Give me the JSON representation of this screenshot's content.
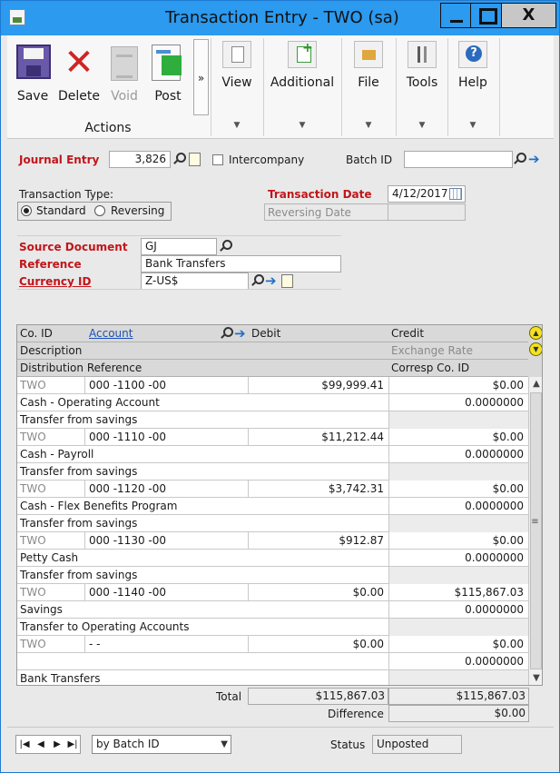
{
  "window": {
    "title": "Transaction Entry  -  TWO (sa)",
    "close_glyph": "X"
  },
  "ribbon": {
    "save": "Save",
    "delete": "Delete",
    "void": "Void",
    "post": "Post",
    "more": "»",
    "group_actions": "Actions",
    "view": "View",
    "additional": "Additional",
    "file": "File",
    "tools": "Tools",
    "help": "Help"
  },
  "header": {
    "journal_entry_label": "Journal Entry",
    "journal_entry_value": "3,826",
    "intercompany_label": "Intercompany",
    "batch_id_label": "Batch ID",
    "batch_id_value": "",
    "transaction_type_label": "Transaction Type:",
    "type_standard": "Standard",
    "type_reversing": "Reversing",
    "transaction_date_label": "Transaction Date",
    "transaction_date_value": "4/12/2017",
    "reversing_date_label": "Reversing Date",
    "reversing_date_value": "",
    "source_document_label": "Source Document",
    "source_document_value": "GJ",
    "reference_label": "Reference",
    "reference_value": "Bank Transfers",
    "currency_id_label": "Currency ID",
    "currency_id_value": "Z-US$"
  },
  "grid": {
    "headers": {
      "co_id": "Co. ID",
      "account": "Account",
      "debit": "Debit",
      "credit": "Credit",
      "description": "Description",
      "exchange_rate": "Exchange Rate",
      "distribution_reference": "Distribution Reference",
      "corresp_co_id": "Corresp Co. ID"
    },
    "entries": [
      {
        "co": "TWO",
        "account": "000 -1100 -00",
        "debit": "$99,999.41",
        "credit": "$0.00",
        "description": "Cash - Operating Account",
        "rate": "0.0000000",
        "dist_ref": "Transfer from savings"
      },
      {
        "co": "TWO",
        "account": "000 -1110 -00",
        "debit": "$11,212.44",
        "credit": "$0.00",
        "description": "Cash - Payroll",
        "rate": "0.0000000",
        "dist_ref": "Transfer from savings"
      },
      {
        "co": "TWO",
        "account": "000 -1120 -00",
        "debit": "$3,742.31",
        "credit": "$0.00",
        "description": "Cash - Flex Benefits Program",
        "rate": "0.0000000",
        "dist_ref": "Transfer from savings"
      },
      {
        "co": "TWO",
        "account": "000 -1130 -00",
        "debit": "$912.87",
        "credit": "$0.00",
        "description": "Petty Cash",
        "rate": "0.0000000",
        "dist_ref": "Transfer from savings"
      },
      {
        "co": "TWO",
        "account": "000 -1140 -00",
        "debit": "$0.00",
        "credit": "$115,867.03",
        "description": "Savings",
        "rate": "0.0000000",
        "dist_ref": "Transfer to Operating Accounts"
      },
      {
        "co": "TWO",
        "account": "    -       -",
        "debit": "$0.00",
        "credit": "$0.00",
        "description": "",
        "rate": "0.0000000",
        "dist_ref": "Bank Transfers"
      }
    ]
  },
  "totals": {
    "total_label": "Total",
    "total_debit": "$115,867.03",
    "total_credit": "$115,867.03",
    "difference_label": "Difference",
    "difference_value": "$0.00"
  },
  "footer": {
    "nav": [
      "|◀",
      "◀",
      "▶",
      "▶|"
    ],
    "sort_by": "by Batch ID",
    "status_label": "Status",
    "status_value": "Unposted"
  }
}
